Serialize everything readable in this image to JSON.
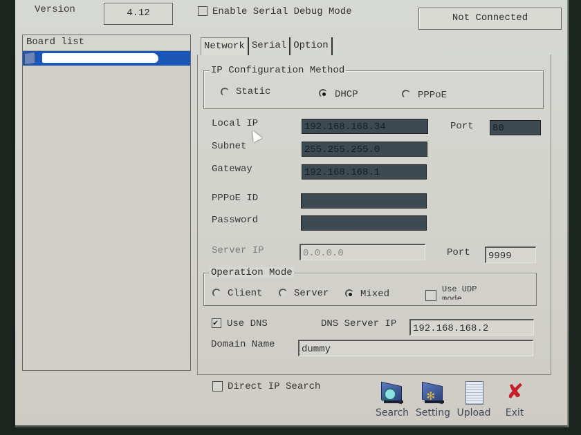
{
  "header": {
    "version_label": "Version",
    "version_value": "4.12",
    "serial_debug_label": "Enable Serial Debug Mode",
    "serial_debug_checked": false,
    "connection_status": "Not Connected"
  },
  "board_list": {
    "title": "Board list",
    "items": [
      {
        "label": "",
        "selected": true,
        "redacted": true
      }
    ]
  },
  "tabs": [
    {
      "label": "Network",
      "active": true
    },
    {
      "label": "Serial",
      "active": false
    },
    {
      "label": "Option",
      "active": false
    }
  ],
  "ip_config": {
    "title": "IP Configuration Method",
    "options": [
      {
        "label": "Static",
        "checked": false
      },
      {
        "label": "DHCP",
        "checked": true
      },
      {
        "label": "PPPoE",
        "checked": false
      }
    ]
  },
  "network": {
    "local_ip_label": "Local IP",
    "local_ip": "192.168.168.34",
    "port_label": "Port",
    "local_port": "80",
    "subnet_label": "Subnet",
    "subnet": "255.255.255.0",
    "gateway_label": "Gateway",
    "gateway": "192.168.168.1",
    "pppoe_id_label": "PPPoE ID",
    "pppoe_id": "",
    "password_label": "Password",
    "password": "",
    "server_ip_label": "Server IP",
    "server_ip": "0.0.0.0",
    "server_port_label": "Port",
    "server_port": "9999"
  },
  "operation_mode": {
    "title": "Operation Mode",
    "options": [
      {
        "label": "Client",
        "checked": false
      },
      {
        "label": "Server",
        "checked": false
      },
      {
        "label": "Mixed",
        "checked": true
      }
    ],
    "udp_label": "Use UDP mode",
    "udp_checked": false
  },
  "dns": {
    "use_dns_label": "Use DNS",
    "use_dns_checked": true,
    "dns_server_label": "DNS Server IP",
    "dns_server_ip": "192.168.168.2",
    "domain_label": "Domain Name",
    "domain_name": "dummy"
  },
  "footer": {
    "direct_ip_label": "Direct IP Search",
    "direct_ip_checked": false,
    "toolbar": [
      {
        "label": "Search",
        "icon": "search-icon"
      },
      {
        "label": "Setting",
        "icon": "setting-icon"
      },
      {
        "label": "Upload",
        "icon": "upload-icon"
      },
      {
        "label": "Exit",
        "icon": "exit-icon"
      }
    ]
  },
  "colors": {
    "selection": "#1a56b8",
    "dark_field": "#3d4a52",
    "exit_red": "#c4202c"
  }
}
